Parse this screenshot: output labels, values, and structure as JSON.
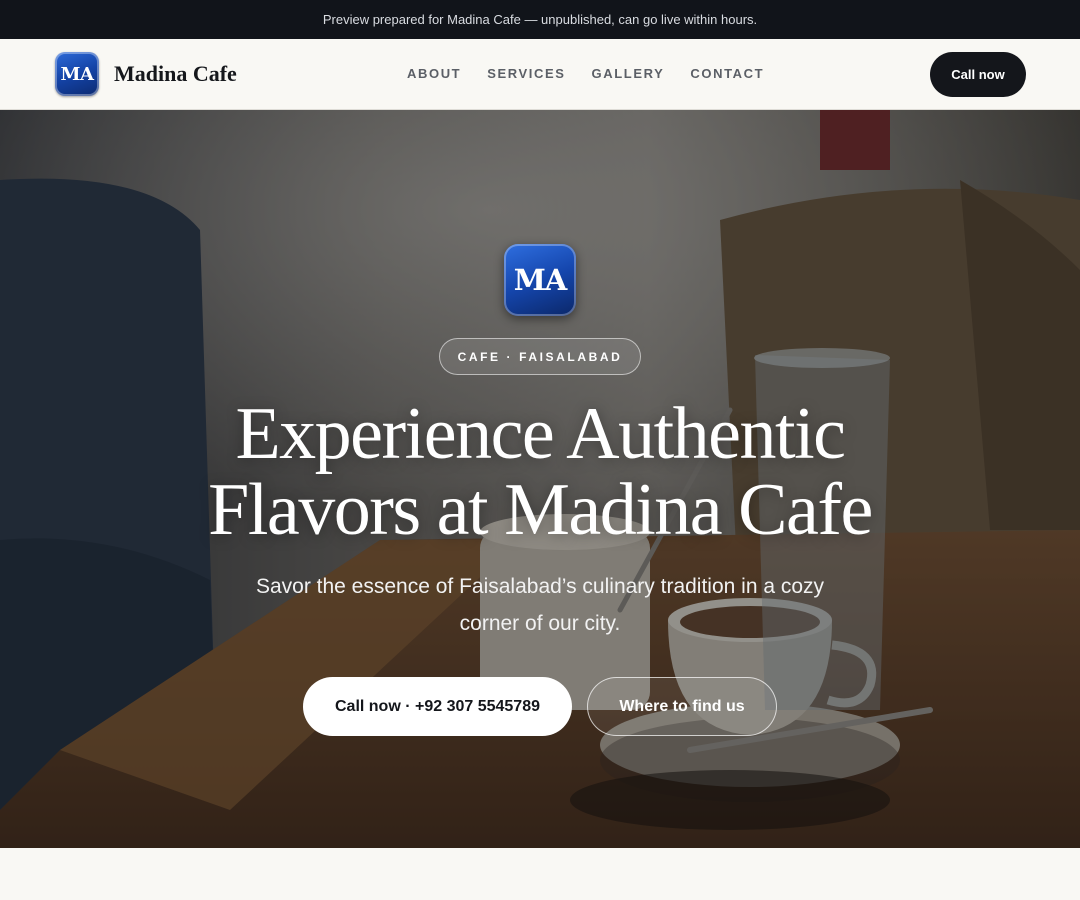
{
  "preview_banner": {
    "text": "Preview prepared for Madina Cafe — unpublished, can go live within hours."
  },
  "header": {
    "logo_text": "MA",
    "brand_name": "Madina Cafe",
    "nav": [
      {
        "label": "ABOUT"
      },
      {
        "label": "SERVICES"
      },
      {
        "label": "GALLERY"
      },
      {
        "label": "CONTACT"
      }
    ],
    "cta_label": "Call now"
  },
  "hero": {
    "logo_text": "MA",
    "tag": "CAFE · FAISALABAD",
    "title_line1": "Experience Authentic",
    "title_line2": "Flavors at Madina Cafe",
    "subtitle": "Savor the essence of Faisalabad’s culinary tradition in a cozy corner of our city.",
    "primary_button": "Call now · +92 307 5545789",
    "secondary_button": "Where to find us",
    "background_image": "coffee-cups-on-wooden-table"
  },
  "colors": {
    "banner_bg": "#11141a",
    "header_bg": "#f9f8f4",
    "dark_button": "#14161b",
    "logo_blue": "#1443a6",
    "page_bg": "#f8f7f3"
  }
}
